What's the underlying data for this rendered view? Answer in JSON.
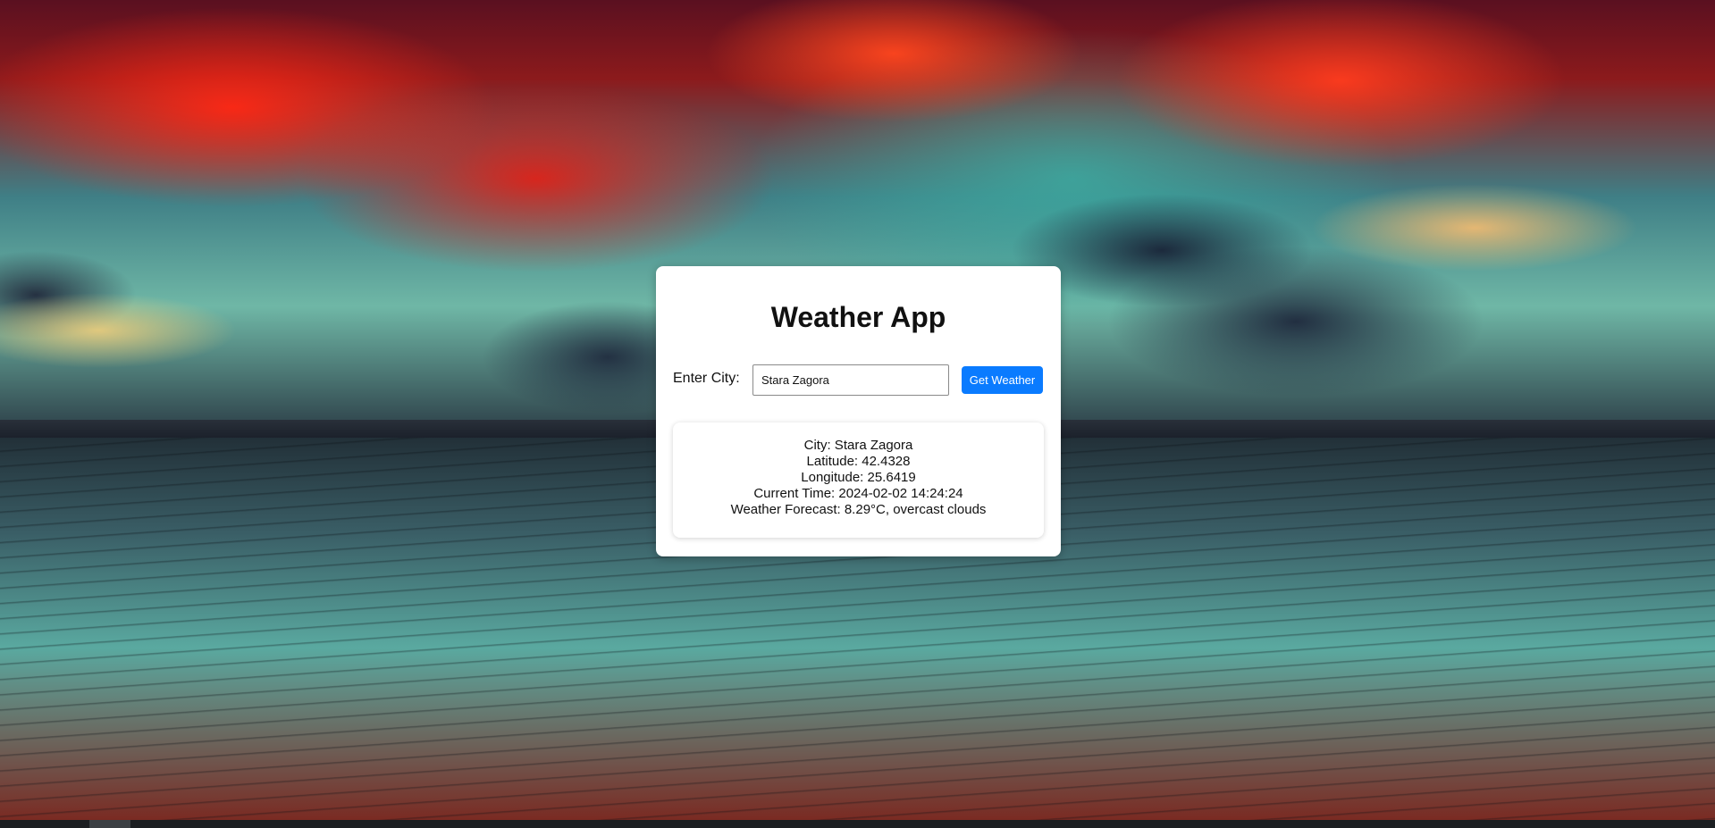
{
  "app": {
    "title": "Weather App"
  },
  "search": {
    "label": "Enter City:",
    "value": "Stara Zagora",
    "button_label": "Get Weather"
  },
  "result": {
    "city": "City: Stara Zagora",
    "latitude": "Latitude: 42.4328",
    "longitude": "Longitude: 25.6419",
    "current_time": "Current Time: 2024-02-02 14:24:24",
    "forecast": "Weather Forecast: 8.29°C, overcast clouds"
  },
  "colors": {
    "accent": "#0a7bff",
    "card_background": "#ffffff",
    "text": "#111111"
  }
}
